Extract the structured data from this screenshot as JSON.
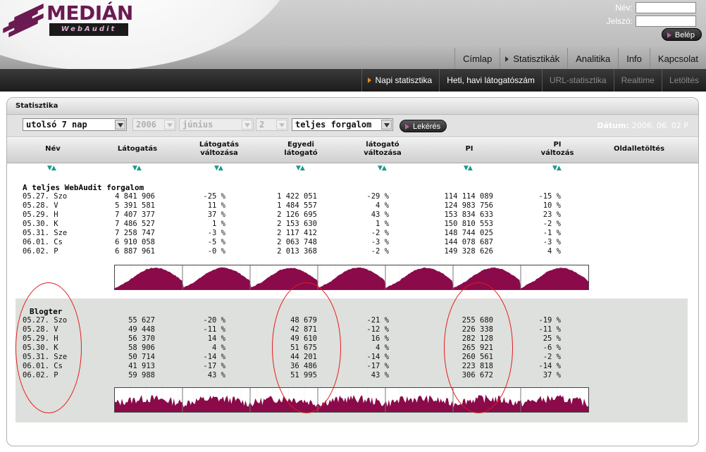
{
  "brand": {
    "logo_text": "MEDIÁN",
    "logo_sub": "WebAudit"
  },
  "login": {
    "name_label": "Név:",
    "password_label": "Jelszó:",
    "button_label": "Belép"
  },
  "nav_primary": [
    "Címlap",
    "Statisztikák",
    "Analitika",
    "Info",
    "Kapcsolat"
  ],
  "nav_primary_active": "Statisztikák",
  "nav_secondary": [
    {
      "label": "Napi statisztika",
      "state": "active"
    },
    {
      "label": "Heti, havi látogatószám",
      "state": "normal"
    },
    {
      "label": "URL-statisztika",
      "state": "dim"
    },
    {
      "label": "Realtime",
      "state": "dim"
    },
    {
      "label": "Letöltés",
      "state": "dim"
    }
  ],
  "panel": {
    "title": "Statisztika"
  },
  "filters": {
    "period": "utolsó 7 nap",
    "year": "2006",
    "month": "június",
    "day": "2",
    "scope": "teljes forgalom",
    "query_button": "Lekérés",
    "date_label": "Dátum:",
    "date_value": "2006. 06. 02 P"
  },
  "columns": [
    {
      "key": "name",
      "label": "Név"
    },
    {
      "key": "visits",
      "label": "Látogatás"
    },
    {
      "key": "visits_change",
      "label": "Látogatás\nváltozása"
    },
    {
      "key": "unique",
      "label": "Egyedi\nlátogató"
    },
    {
      "key": "unique_change",
      "label": "látogató\nváltozása"
    },
    {
      "key": "pi",
      "label": "PI"
    },
    {
      "key": "pi_change",
      "label": "PI\nváltozás"
    },
    {
      "key": "download",
      "label": "Oldalletöltés"
    }
  ],
  "sort_glyph": "▼▲",
  "groups": [
    {
      "title": "A teljes WebAudit forgalom",
      "rows": [
        {
          "date": "05.27. Szo",
          "visits": "4 841 906",
          "visits_change": "-25 %",
          "unique": "1 422 051",
          "unique_change": "-29 %",
          "pi": "114 114 089",
          "pi_change": "-15 %"
        },
        {
          "date": "05.28. V",
          "visits": "5 391 581",
          "visits_change": "11 %",
          "unique": "1 484 557",
          "unique_change": "4 %",
          "pi": "124 983 756",
          "pi_change": "10 %"
        },
        {
          "date": "05.29. H",
          "visits": "7 407 377",
          "visits_change": "37 %",
          "unique": "2 126 695",
          "unique_change": "43 %",
          "pi": "153 834 633",
          "pi_change": "23 %"
        },
        {
          "date": "05.30. K",
          "visits": "7 486 527",
          "visits_change": "1 %",
          "unique": "2 153 630",
          "unique_change": "1 %",
          "pi": "150 810 553",
          "pi_change": "-2 %"
        },
        {
          "date": "05.31. Sze",
          "visits": "7 258 747",
          "visits_change": "-3 %",
          "unique": "2 117 412",
          "unique_change": "-2 %",
          "pi": "148 744 025",
          "pi_change": "-1 %"
        },
        {
          "date": "06.01. Cs",
          "visits": "6 910 058",
          "visits_change": "-5 %",
          "unique": "2 063 748",
          "unique_change": "-3 %",
          "pi": "144 078 687",
          "pi_change": "-3 %"
        },
        {
          "date": "06.02. P",
          "visits": "6 887 961",
          "visits_change": "-0 %",
          "unique": "2 013 368",
          "unique_change": "-2 %",
          "pi": "149 328 626",
          "pi_change": "4 %"
        }
      ]
    },
    {
      "title": "Blogter",
      "rows": [
        {
          "date": "05.27. Szo",
          "visits": "55 627",
          "visits_change": "-20 %",
          "unique": "48 679",
          "unique_change": "-21 %",
          "pi": "255 680",
          "pi_change": "-19 %"
        },
        {
          "date": "05.28. V",
          "visits": "49 448",
          "visits_change": "-11 %",
          "unique": "42 871",
          "unique_change": "-12 %",
          "pi": "226 338",
          "pi_change": "-11 %"
        },
        {
          "date": "05.29. H",
          "visits": "56 370",
          "visits_change": "14 %",
          "unique": "49 610",
          "unique_change": "16 %",
          "pi": "282 128",
          "pi_change": "25 %"
        },
        {
          "date": "05.30. K",
          "visits": "58 906",
          "visits_change": "4 %",
          "unique": "51 675",
          "unique_change": "4 %",
          "pi": "265 921",
          "pi_change": "-6 %"
        },
        {
          "date": "05.31. Sze",
          "visits": "50 714",
          "visits_change": "-14 %",
          "unique": "44 201",
          "unique_change": "-14 %",
          "pi": "260 561",
          "pi_change": "-2 %"
        },
        {
          "date": "06.01. Cs",
          "visits": "41 913",
          "visits_change": "-17 %",
          "unique": "36 486",
          "unique_change": "-17 %",
          "pi": "223 818",
          "pi_change": "-14 %"
        },
        {
          "date": "06.02. P",
          "visits": "59 988",
          "visits_change": "43 %",
          "unique": "51 995",
          "unique_change": "43 %",
          "pi": "306 672",
          "pi_change": "37 %"
        }
      ]
    }
  ],
  "colors": {
    "sparkline_fill": "#8a0a4a",
    "sort_arrow": "#1f9a8a",
    "annotation": "#e51a1a",
    "highlight_group_bg": "#dde0dc",
    "nav_active_marker": "#e09020"
  }
}
